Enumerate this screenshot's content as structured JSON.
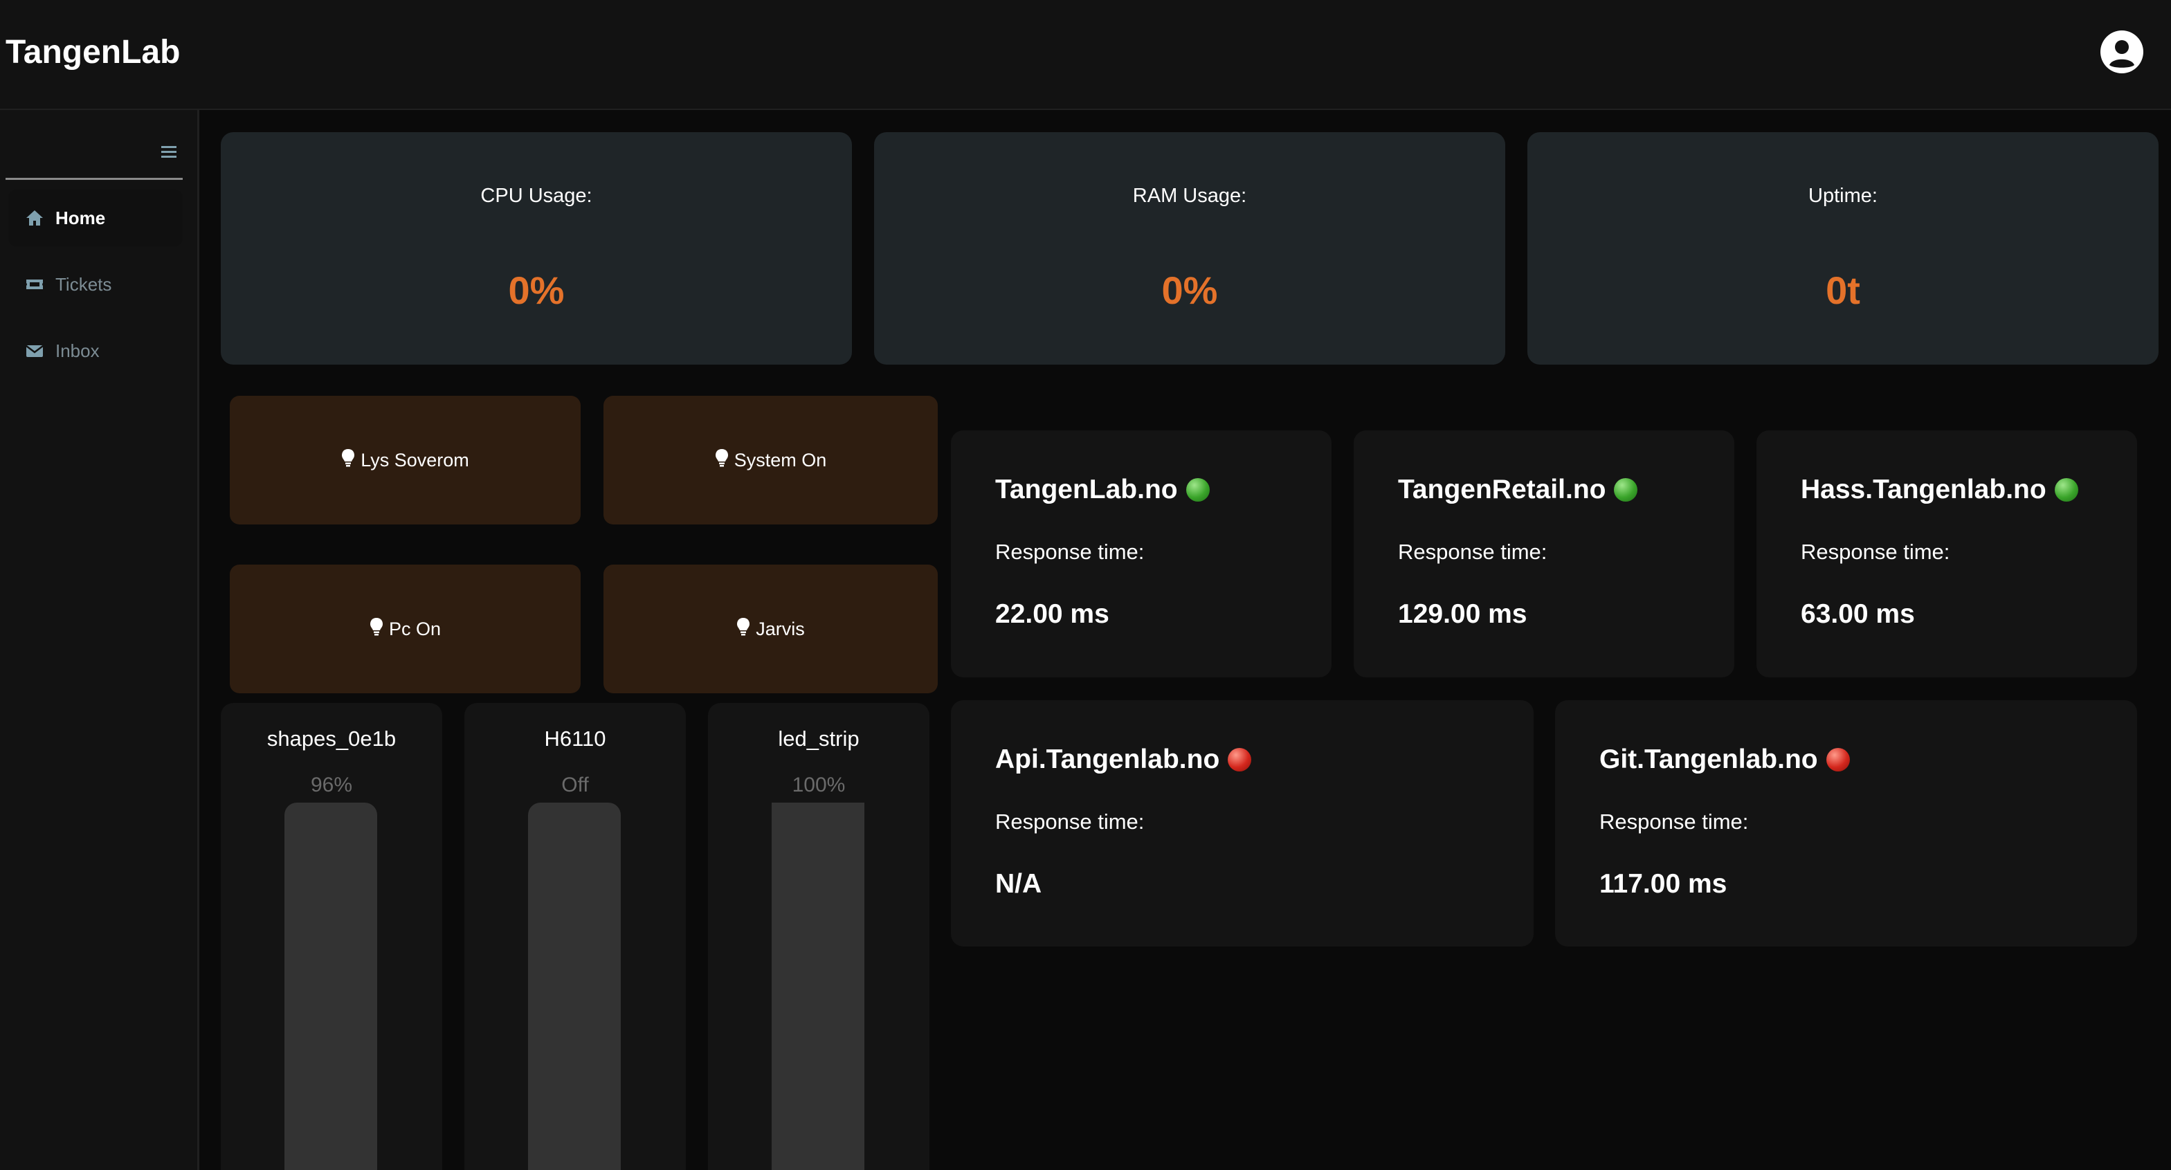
{
  "header": {
    "title": "TangenLab",
    "account_icon": "user-circle-icon"
  },
  "sidebar": {
    "toggle_icon": "hamburger-icon",
    "items": [
      {
        "label": "Home",
        "icon": "home-icon",
        "active": true
      },
      {
        "label": "Tickets",
        "icon": "ticket-icon",
        "active": false
      },
      {
        "label": "Inbox",
        "icon": "envelope-icon",
        "active": false
      }
    ]
  },
  "stats": [
    {
      "label": "CPU Usage:",
      "value": "0%"
    },
    {
      "label": "RAM Usage:",
      "value": "0%"
    },
    {
      "label": "Uptime:",
      "value": "0t"
    }
  ],
  "scenes": [
    {
      "label": "Lys Soverom",
      "icon": "lightbulb-icon"
    },
    {
      "label": "System On",
      "icon": "lightbulb-icon"
    },
    {
      "label": "Pc On",
      "icon": "lightbulb-icon"
    },
    {
      "label": "Jarvis",
      "icon": "lightbulb-icon"
    }
  ],
  "lights": [
    {
      "name": "shapes_0e1b",
      "level_text": "96%",
      "level": 0.96
    },
    {
      "name": "H6110",
      "level_text": "Off",
      "level": 0
    },
    {
      "name": "led_strip",
      "level_text": "100%",
      "level": 1.0
    }
  ],
  "sites": [
    {
      "name": "TangenLab.no",
      "status": "up",
      "label": "Response time:",
      "value": "22.00 ms"
    },
    {
      "name": "TangenRetail.no",
      "status": "up",
      "label": "Response time:",
      "value": "129.00 ms"
    },
    {
      "name": "Hass.Tangenlab.no",
      "status": "up",
      "label": "Response time:",
      "value": "63.00 ms"
    },
    {
      "name": "Api.Tangenlab.no",
      "status": "down",
      "label": "Response time:",
      "value": "N/A"
    },
    {
      "name": "Git.Tangenlab.no",
      "status": "down",
      "label": "Response time:",
      "value": "117.00 ms"
    }
  ],
  "colors": {
    "accent": "#e4722a",
    "scene_bg": "#2e1d10",
    "card_bg": "#1f2528",
    "status_up": "#3aa42a",
    "status_down": "#d4271d"
  }
}
